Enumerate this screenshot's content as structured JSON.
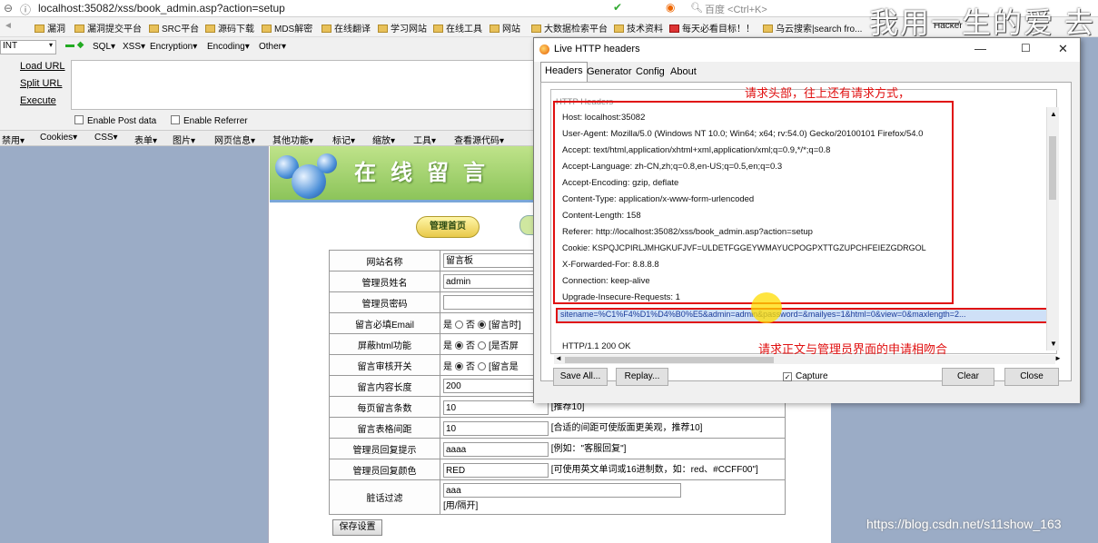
{
  "browser": {
    "url": "localhost:35082/xss/book_admin.asp?action=setup",
    "search_placeholder": "百度 <Ctrl+K>",
    "bookmarks": [
      "漏洞",
      "漏洞提交平台",
      "SRC平台",
      "源码下载",
      "MDS解密",
      "在线翻译",
      "学习网站",
      "在线工具",
      "网站",
      "大数据检索平台",
      "技术资料",
      "每天必看目标！！",
      "乌云搜索|search fro..."
    ],
    "bookmark_tail": "Hacker"
  },
  "hackbar": {
    "select_value": "INT",
    "menu": [
      "SQL▾",
      "XSS▾",
      "Encryption▾",
      "Encoding▾",
      "Other▾"
    ],
    "load_url": "Load URL",
    "split_url": "Split URL",
    "execute": "Execute",
    "enable_post": "Enable Post data",
    "enable_referrer": "Enable Referrer"
  },
  "toolbar2": [
    "禁用▾",
    "Cookies▾",
    "CSS▾",
    "表单▾",
    "图片▾",
    "网页信息▾",
    "其他功能▾",
    "标记▾",
    "缩放▾",
    "工具▾",
    "查看源代码▾"
  ],
  "guestbook": {
    "banner_title": "在线留言",
    "admin_button": "管理首页",
    "rows": [
      {
        "label": "网站名称",
        "value": "留言板"
      },
      {
        "label": "管理员姓名",
        "value": "admin"
      },
      {
        "label": "管理员密码",
        "value": ""
      },
      {
        "label": "留言必填Email",
        "radio": [
          "是",
          "否"
        ],
        "selected": 1,
        "hint": "[留言时]"
      },
      {
        "label": "屏蔽html功能",
        "radio": [
          "是",
          "否"
        ],
        "selected": 0,
        "hint": "[是否屏"
      },
      {
        "label": "留言审核开关",
        "radio": [
          "是",
          "否"
        ],
        "selected": 0,
        "hint": "[留言是"
      },
      {
        "label": "留言内容长度",
        "value": "200"
      },
      {
        "label": "每页留言条数",
        "value": "10",
        "hint": "[推荐10]"
      },
      {
        "label": "留言表格间距",
        "value": "10",
        "hint": "[合适的间距可使版面更美观，推荐10]"
      },
      {
        "label": "管理员回复提示",
        "value": "aaaa",
        "hint": "[例如：\"客服回复\"]"
      },
      {
        "label": "管理员回复颜色",
        "value": "RED",
        "hint": "[可使用英文单词或16进制数，如：red、#CCFF00\"]"
      },
      {
        "label": "脏话过滤",
        "value": "aaa",
        "sub": "[用/隔开]"
      }
    ],
    "save_button": "保存设置"
  },
  "dialog": {
    "title": "Live HTTP headers",
    "tabs": [
      "Headers",
      "Generator",
      "Config",
      "About"
    ],
    "section": "HTTP Headers",
    "headers": [
      "Host: localhost:35082",
      "User-Agent: Mozilla/5.0 (Windows NT 10.0; Win64; x64; rv:54.0) Gecko/20100101 Firefox/54.0",
      "Accept: text/html,application/xhtml+xml,application/xml;q=0.9,*/*;q=0.8",
      "Accept-Language: zh-CN,zh;q=0.8,en-US;q=0.5,en;q=0.3",
      "Accept-Encoding: gzip, deflate",
      "Content-Type: application/x-www-form-urlencoded",
      "Content-Length: 158",
      "Referer: http://localhost:35082/xss/book_admin.asp?action=setup",
      "Cookie: KSPQJCPIRLJMHGKUFJVF=ULDETFGGEYWMAYUCPOGPXTTGZUPCHFEIEZGDRGOL",
      "X-Forwarded-For: 8.8.8.8",
      "Connection: keep-alive",
      "Upgrade-Insecure-Requests: 1"
    ],
    "post_body": "sitename=%C1%F4%D1%D4%B0%E5&admin=admin&password=&mailyes=1&html=0&view=0&maxlength=2...",
    "response": "HTTP/1.1 200 OK",
    "buttons": {
      "save_all": "Save All...",
      "replay": "Replay...",
      "capture": "Capture",
      "clear": "Clear",
      "close": "Close"
    },
    "capture_checked": true
  },
  "annotations": {
    "headers_note": "请求头部，往上还有请求方式，",
    "body_note": "请求正文与管理员界面的申请相吻合"
  },
  "overlay": {
    "watermark": "我用一生的爱 去",
    "blog": "https://blog.csdn.net/s11show_163"
  },
  "colors": {
    "annotation": "#e01010",
    "page_bg": "#9bacc6"
  }
}
